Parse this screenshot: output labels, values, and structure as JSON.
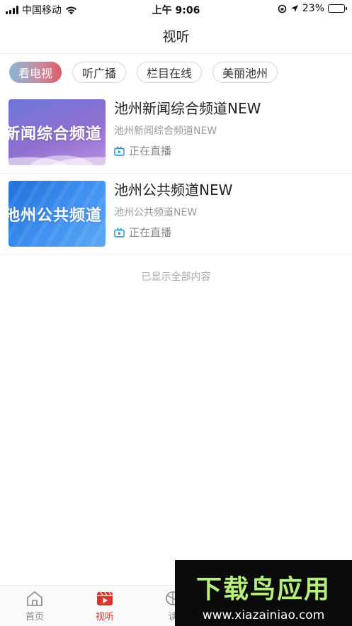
{
  "status_bar": {
    "carrier": "中国移动",
    "time": "上午 9:06",
    "battery": "23%",
    "battery_level": 0.23
  },
  "nav": {
    "title": "视听"
  },
  "tabs": [
    {
      "label": "看电视",
      "active": true
    },
    {
      "label": "听广播",
      "active": false
    },
    {
      "label": "栏目在线",
      "active": false
    },
    {
      "label": "美丽池州",
      "active": false
    }
  ],
  "channels": [
    {
      "thumb_text": "新闻综合频道",
      "title": "池州新闻综合频道NEW",
      "subtitle": "池州新闻综合频道NEW",
      "status": "正在直播",
      "thumb_icon": "purple-clouds-thumbnail"
    },
    {
      "thumb_text": "池州公共频道",
      "title": "池州公共频道NEW",
      "subtitle": "池州公共频道NEW",
      "status": "正在直播",
      "thumb_icon": "blue-stripes-thumbnail"
    }
  ],
  "end_note": "已显示全部内容",
  "tabbar": {
    "items": [
      {
        "label": "首页",
        "icon": "home-icon"
      },
      {
        "label": "视听",
        "icon": "play-icon",
        "active": true
      },
      {
        "label": "读",
        "icon": "read-icon"
      }
    ]
  },
  "watermark": {
    "logo": "下载鸟应用",
    "url": "www.xiazainiao.com"
  },
  "colors": {
    "accent": "#d8352c",
    "live_icon": "#1b8fd8"
  }
}
